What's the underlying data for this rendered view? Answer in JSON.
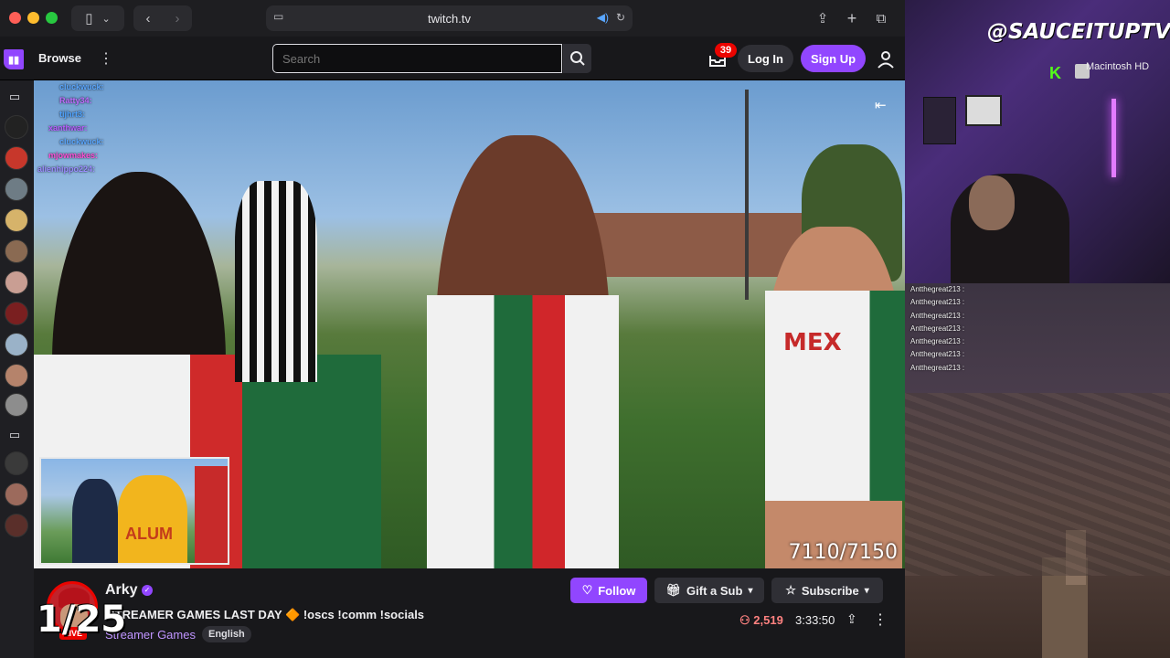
{
  "browser": {
    "url": "twitch.tv"
  },
  "nav": {
    "browse": "Browse",
    "search_placeholder": "Search",
    "notifications_count": "39",
    "login": "Log In",
    "signup": "Sign Up"
  },
  "video": {
    "chat_overlay": [
      {
        "name": "cluckwuck:",
        "color": "#5aa7ff"
      },
      {
        "name": "Ratty34:",
        "color": "#c06cff"
      },
      {
        "name": "tijhrt3:",
        "color": "#4fa3ff"
      },
      {
        "name": "xanthwar:",
        "color": "#b95cff"
      },
      {
        "name": "cluckwuck:",
        "color": "#5aa7ff"
      },
      {
        "name": "mjowmakes:",
        "color": "#ff4fd7"
      },
      {
        "name": "alienhippo224:",
        "color": "#9b8cff"
      }
    ],
    "pip_shirt_text": "ALUM",
    "jersey_text": "MEX",
    "counter": "7110/7150"
  },
  "channel": {
    "streamer": "Arky",
    "title": "STREAMER GAMES LAST DAY 🔶 !oscs !comm !socials",
    "category": "Streamer Games",
    "language": "English",
    "live": "LIVE",
    "follow": "Follow",
    "gift": "Gift a Sub",
    "subscribe": "Subscribe",
    "viewers": "2,519",
    "uptime": "3:33:50",
    "overlay_count": "1/25"
  },
  "right_panel": {
    "handle": "@SAUCEITUPTV",
    "drive_label": "Macintosh HD",
    "chat_log": [
      "Antthegreat213 :",
      "Antthegreat213 :",
      "Antthegreat213 :",
      "Antthegreat213 :",
      "Antthegreat213 :",
      "Antthegreat213 :",
      "Antthegreat213 :"
    ]
  }
}
